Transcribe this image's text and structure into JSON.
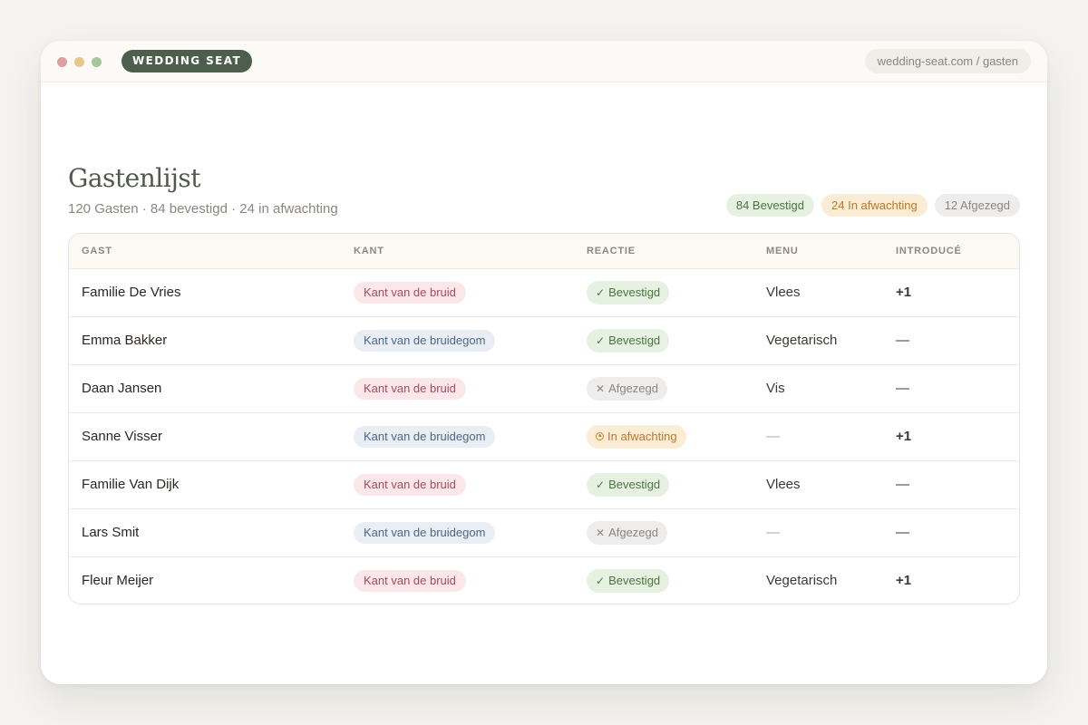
{
  "window": {
    "brand": "WEDDING SEAT",
    "url": "wedding-seat.com / gasten"
  },
  "header": {
    "title": "Gastenlijst",
    "subtitle": "120 Gasten · 84 bevestigd · 24 in afwachting",
    "summary": {
      "confirmed": "84 Bevestigd",
      "pending": "24 In afwachting",
      "declined": "12 Afgezegd"
    }
  },
  "table": {
    "columns": [
      "GAST",
      "KANT",
      "REACTIE",
      "MENU",
      "INTRODUCÉ"
    ],
    "rows": [
      {
        "name": "Familie De Vries",
        "side": "Kant van de bruid",
        "side_type": "bride",
        "status": "Bevestigd",
        "status_type": "ok",
        "menu": "Vlees",
        "plus": "+1"
      },
      {
        "name": "Emma Bakker",
        "side": "Kant van de bruidegom",
        "side_type": "groom",
        "status": "Bevestigd",
        "status_type": "ok",
        "menu": "Vegetarisch",
        "plus": "—"
      },
      {
        "name": "Daan Jansen",
        "side": "Kant van de bruid",
        "side_type": "bride",
        "status": "Afgezegd",
        "status_type": "declined",
        "menu": "Vis",
        "plus": "—"
      },
      {
        "name": "Sanne Visser",
        "side": "Kant van de bruidegom",
        "side_type": "groom",
        "status": "In afwachting",
        "status_type": "pending",
        "menu": "—",
        "plus": "+1"
      },
      {
        "name": "Familie Van Dijk",
        "side": "Kant van de bruid",
        "side_type": "bride",
        "status": "Bevestigd",
        "status_type": "ok",
        "menu": "Vlees",
        "plus": "—"
      },
      {
        "name": "Lars Smit",
        "side": "Kant van de bruidegom",
        "side_type": "groom",
        "status": "Afgezegd",
        "status_type": "declined",
        "menu": "—",
        "plus": "—"
      },
      {
        "name": "Fleur Meijer",
        "side": "Kant van de bruid",
        "side_type": "bride",
        "status": "Bevestigd",
        "status_type": "ok",
        "menu": "Vegetarisch",
        "plus": "+1"
      }
    ]
  }
}
